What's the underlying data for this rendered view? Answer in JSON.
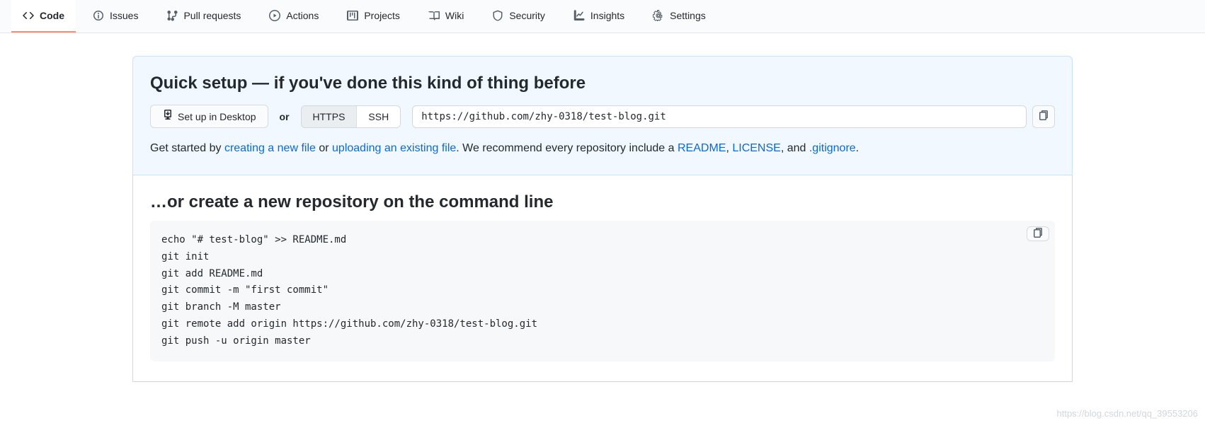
{
  "nav": {
    "tabs": [
      {
        "label": "Code",
        "icon": "code",
        "selected": true
      },
      {
        "label": "Issues",
        "icon": "issue",
        "selected": false
      },
      {
        "label": "Pull requests",
        "icon": "pr",
        "selected": false
      },
      {
        "label": "Actions",
        "icon": "play",
        "selected": false
      },
      {
        "label": "Projects",
        "icon": "project",
        "selected": false
      },
      {
        "label": "Wiki",
        "icon": "book",
        "selected": false
      },
      {
        "label": "Security",
        "icon": "shield",
        "selected": false
      },
      {
        "label": "Insights",
        "icon": "graph",
        "selected": false
      },
      {
        "label": "Settings",
        "icon": "gear",
        "selected": false
      }
    ]
  },
  "quick_setup": {
    "heading": "Quick setup — if you've done this kind of thing before",
    "desktop_btn": "Set up in Desktop",
    "or": "or",
    "proto": {
      "https": "HTTPS",
      "ssh": "SSH",
      "selected": "https"
    },
    "clone_url": "https://github.com/zhy-0318/test-blog.git",
    "para": {
      "p1": "Get started by ",
      "link_new_file": "creating a new file",
      "p2": " or ",
      "link_upload": "uploading an existing file",
      "p3": ". We recommend every repository include a ",
      "link_readme": "README",
      "comma1": ", ",
      "link_license": "LICENSE",
      "comma2": ", and ",
      "link_gitignore": ".gitignore",
      "p4": "."
    }
  },
  "cmdline": {
    "heading": "…or create a new repository on the command line",
    "commands": "echo \"# test-blog\" >> README.md\ngit init\ngit add README.md\ngit commit -m \"first commit\"\ngit branch -M master\ngit remote add origin https://github.com/zhy-0318/test-blog.git\ngit push -u origin master"
  },
  "watermark": "https://blog.csdn.net/qq_39553206"
}
